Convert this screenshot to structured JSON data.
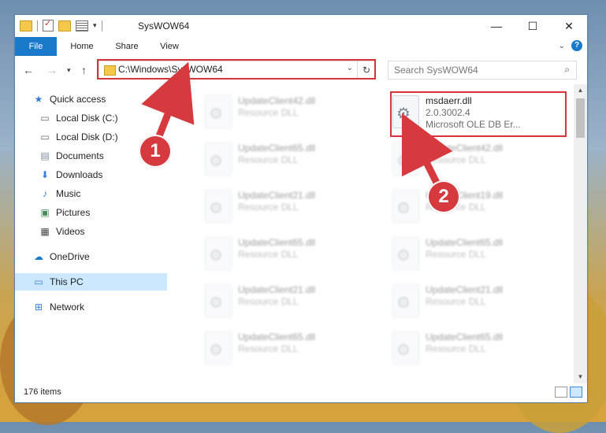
{
  "window": {
    "title": "SysWOW64",
    "controls": [
      "—",
      "☐",
      "✕"
    ]
  },
  "ribbon": {
    "tabs": [
      "File",
      "Home",
      "Share",
      "View"
    ]
  },
  "address": {
    "path": "C:\\Windows\\SysWOW64"
  },
  "search": {
    "placeholder": "Search SysWOW64"
  },
  "sidebar": {
    "items": [
      {
        "label": "Quick access",
        "icon": "star-icon",
        "pinned": false
      },
      {
        "label": "Local Disk (C:)",
        "icon": "drive-icon",
        "pinned": true
      },
      {
        "label": "Local Disk (D:)",
        "icon": "drive-icon",
        "pinned": false
      },
      {
        "label": "Documents",
        "icon": "documents-icon",
        "pinned": true
      },
      {
        "label": "Downloads",
        "icon": "download-icon",
        "pinned": true
      },
      {
        "label": "Music",
        "icon": "music-icon",
        "pinned": true
      },
      {
        "label": "Pictures",
        "icon": "pictures-icon",
        "pinned": true
      },
      {
        "label": "Videos",
        "icon": "videos-icon",
        "pinned": true
      },
      {
        "label": "OneDrive",
        "icon": "cloud-icon",
        "pinned": false
      },
      {
        "label": "This PC",
        "icon": "computer-icon",
        "pinned": false,
        "selected": true
      },
      {
        "label": "Network",
        "icon": "network-icon",
        "pinned": false
      }
    ]
  },
  "files": {
    "left": [
      {
        "name": "UpdateClient42.dll",
        "type": "Resource DLL"
      },
      {
        "name": "UpdateClient65.dll",
        "type": "Resource DLL"
      },
      {
        "name": "UpdateClient21.dll",
        "type": "Resource DLL"
      },
      {
        "name": "UpdateClient65.dll",
        "type": "Resource DLL"
      },
      {
        "name": "UpdateClient21.dll",
        "type": "Resource DLL"
      },
      {
        "name": "UpdateClient65.dll",
        "type": "Resource DLL"
      }
    ],
    "right": [
      {
        "name": "msdaerr.dll",
        "version": "2.0.3002.4",
        "type": "Microsoft OLE DB Er..."
      },
      {
        "name": "UpdateClient42.dll",
        "type": "Resource DLL"
      },
      {
        "name": "UpdateClient19.dll",
        "type": "Resource DLL"
      },
      {
        "name": "UpdateClient65.dll",
        "type": "Resource DLL"
      },
      {
        "name": "UpdateClient21.dll",
        "type": "Resource DLL"
      },
      {
        "name": "UpdateClient65.dll",
        "type": "Resource DLL"
      }
    ]
  },
  "status": {
    "count": "176 items"
  },
  "callouts": {
    "one": "1",
    "two": "2"
  },
  "colors": {
    "accent": "#1979ca",
    "highlight": "#d9343c",
    "selected": "#cce8ff"
  }
}
